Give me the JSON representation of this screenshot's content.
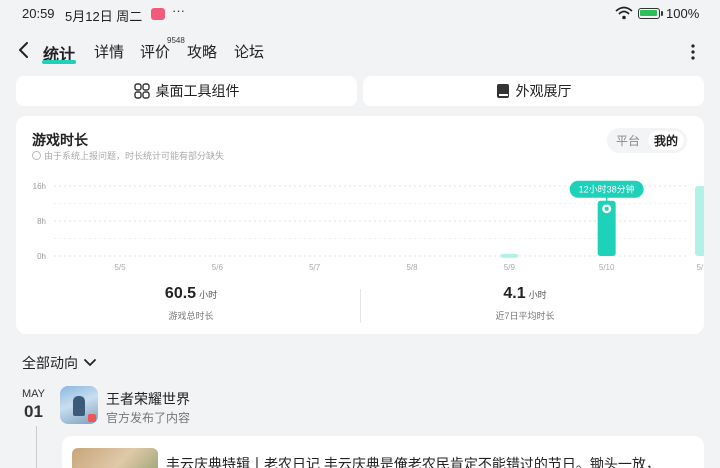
{
  "status_bar": {
    "time": "20:59",
    "date": "5月12日 周二",
    "more": "···",
    "battery_pct": "100%",
    "battery_level": 1.0,
    "battery_color": "#2fbf5a"
  },
  "nav": {
    "tabs": [
      "统计",
      "详情",
      "评价",
      "攻略",
      "论坛"
    ],
    "active_index": 0,
    "review_count": "9548",
    "accent": "#1ed1b9"
  },
  "tools": {
    "widget_label": "桌面工具组件",
    "gallery_label": "外观展厅"
  },
  "playtime": {
    "title": "游戏时长",
    "note": "由于系统上报问题，时长统计可能有部分缺失",
    "toggle": {
      "platform": "平台",
      "mine": "我的",
      "selected": "mine"
    },
    "total_value": "60.5",
    "total_unit": "小时",
    "total_label": "游戏总时长",
    "avg_value": "4.1",
    "avg_unit": "小时",
    "avg_label": "近7日平均时长"
  },
  "chart_data": {
    "type": "bar",
    "categories": [
      "5/5",
      "5/6",
      "5/7",
      "5/8",
      "5/9",
      "5/10",
      "5/11"
    ],
    "values": [
      0,
      0,
      0,
      0,
      0.5,
      12.63,
      16
    ],
    "y_ticks": [
      "0h",
      "8h",
      "16h"
    ],
    "ylim": [
      0,
      16
    ],
    "selected_index": 5,
    "tooltip": "12小时38分钟",
    "selected_color": "#1ed1b9",
    "bar_color": "#b3f0e8",
    "grid": true
  },
  "feed": {
    "heading": "全部动向",
    "month": "MAY",
    "day": "01",
    "game_name": "王者荣耀世界",
    "game_sub": "官方发布了内容",
    "post_text": "丰云庆典特辑丨老农日记 丰云庆典是俺老农民肯定不能错过的节日。锄头一放，"
  }
}
